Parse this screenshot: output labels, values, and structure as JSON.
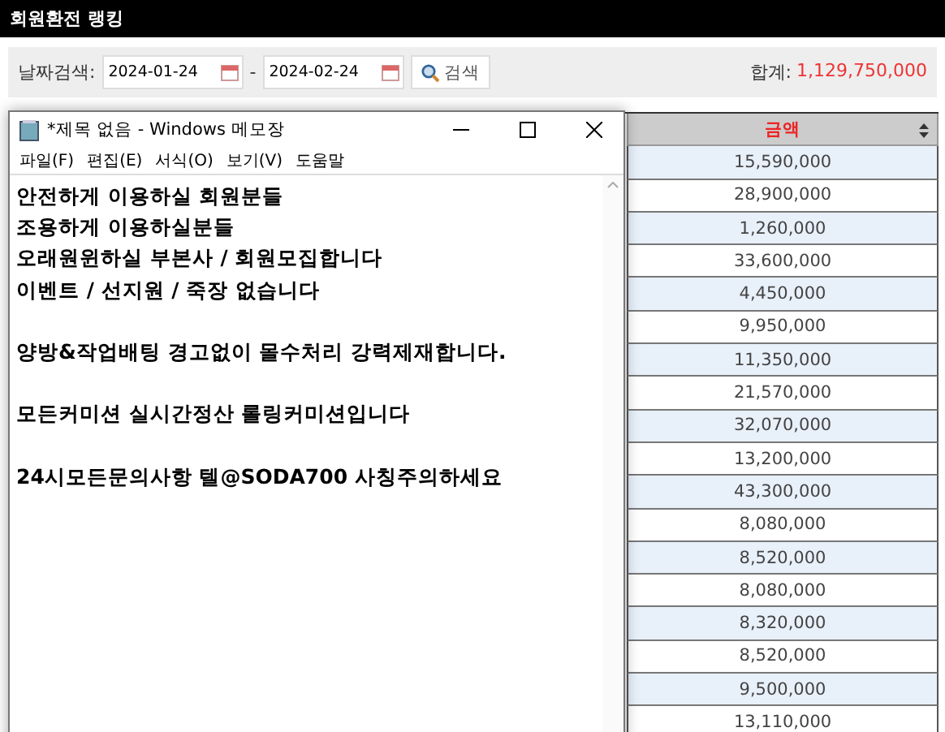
{
  "page_title": "회원환전 랭킹",
  "search": {
    "label": "날짜검색:",
    "date_from": "2024-01-24",
    "separator": "-",
    "date_to": "2024-02-24",
    "button": "검색"
  },
  "total": {
    "label": "합계:",
    "value": "1,129,750,000"
  },
  "table": {
    "column": "금액",
    "rows": [
      "15,590,000",
      "28,900,000",
      "1,260,000",
      "33,600,000",
      "4,450,000",
      "9,950,000",
      "11,350,000",
      "21,570,000",
      "32,070,000",
      "13,200,000",
      "43,300,000",
      "8,080,000",
      "8,520,000",
      "8,080,000",
      "8,320,000",
      "8,520,000",
      "9,500,000",
      "13,110,000"
    ]
  },
  "notepad": {
    "title": "*제목 없음 - Windows 메모장",
    "menu": [
      "파일(F)",
      "편집(E)",
      "서식(O)",
      "보기(V)",
      "도움말"
    ],
    "paragraphs": [
      [
        "안전하게 이용하실 회원분들",
        "조용하게 이용하실분들",
        "오래원윈하실 부본사 / 회원모집합니다",
        "이벤트 / 선지원 / 죽장 없습니다"
      ],
      [
        "양방&작업배팅 경고없이 몰수처리 강력제재합니다."
      ],
      [
        "모든커미션 실시간정산 롤링커미션입니다"
      ],
      [
        "24시모든문의사항 텔@SODA700 사칭주의하세요"
      ]
    ]
  }
}
